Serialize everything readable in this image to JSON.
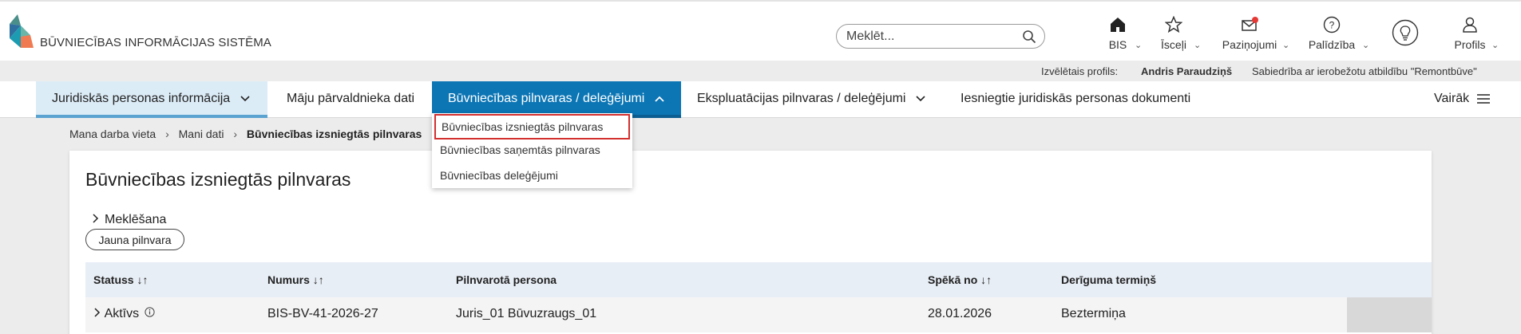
{
  "header": {
    "brand": "BŪVNIECĪBAS INFORMĀCIJAS SISTĒMA",
    "search_placeholder": "Meklēt...",
    "items": [
      {
        "label": "BIS",
        "icon": "home-icon"
      },
      {
        "label": "Īsceļi",
        "icon": "star-icon"
      },
      {
        "label": "Paziņojumi",
        "icon": "mail-icon"
      },
      {
        "label": "Palīdzība",
        "icon": "help-icon"
      },
      {
        "label": "",
        "icon": "lightbulb-icon"
      },
      {
        "label": "Profils",
        "icon": "user-icon"
      }
    ]
  },
  "profile": {
    "label": "Izvēlētais profils:",
    "name": "Andris Paraudziņš",
    "company": "Sabiedrība ar ierobežotu atbildību \"Remontbūve\""
  },
  "nav": {
    "items": [
      "Juridiskās personas informācija",
      "Māju pārvaldnieka dati",
      "Būvniecības pilnvaras / deleģējumi",
      "Ekspluatācijas pilnvaras / deleģējumi",
      "Iesniegtie juridiskās personas dokumenti"
    ],
    "more": "Vairāk"
  },
  "dropdown": {
    "items": [
      "Būvniecības izsniegtās pilnvaras",
      "Būvniecības saņemtās pilnvaras",
      "Būvniecības deleģējumi"
    ]
  },
  "breadcrumb": {
    "items": [
      "Mana darba vieta",
      "Mani dati",
      "Būvniecības izsniegtās pilnvaras"
    ]
  },
  "page": {
    "title": "Būvniecības izsniegtās pilnvaras",
    "search_toggle": "Meklēšana",
    "new_button": "Jauna pilnvara"
  },
  "table": {
    "columns": [
      "Statuss ↓↑",
      "Numurs ↓↑",
      "Pilnvarotā persona",
      "Spēkā no ↓↑",
      "Derīguma termiņš"
    ],
    "rows": [
      {
        "status": "Aktīvs",
        "number": "BIS-BV-41-2026-27",
        "person": "Juris_01 Būvuzraugs_01",
        "valid_from": "28.01.2026",
        "validity": "Beztermiņa"
      }
    ]
  },
  "colors": {
    "accent": "#0c76b5",
    "nav_light": "#dcecf7",
    "highlight": "#d32f2f"
  }
}
